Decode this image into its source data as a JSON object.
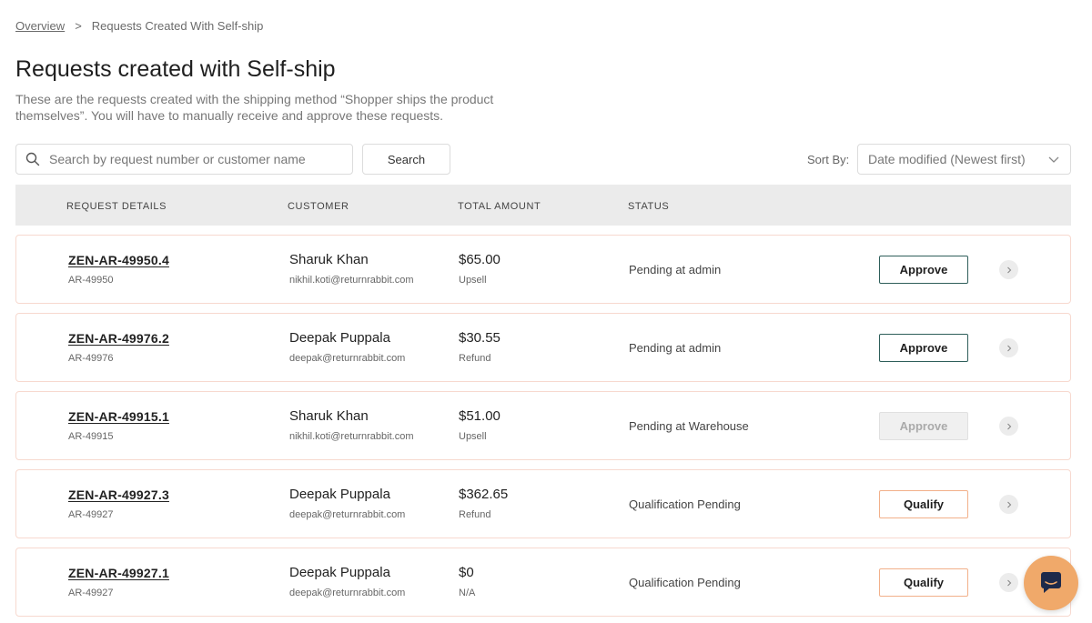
{
  "breadcrumb": {
    "root": "Overview",
    "separator": ">",
    "current": "Requests Created With Self-ship"
  },
  "page": {
    "title": "Requests created with Self-ship",
    "description": "These are the requests created with the shipping method “Shopper ships the product themselves”. You will have to manually receive and approve these requests."
  },
  "search": {
    "placeholder": "Search by request number or customer name",
    "value": "",
    "button_label": "Search",
    "icon": "search-icon"
  },
  "sort": {
    "label": "Sort By:",
    "selected": "Date modified (Newest first)",
    "icon": "chevron-down-icon"
  },
  "table": {
    "headers": {
      "details": "REQUEST DETAILS",
      "customer": "CUSTOMER",
      "amount": "TOTAL AMOUNT",
      "status": "STATUS"
    },
    "rows": [
      {
        "id": "ZEN-AR-49950.4",
        "sub": "AR-49950",
        "customer": "Sharuk Khan",
        "email": "nikhil.koti@returnrabbit.com",
        "amount": "$65.00",
        "type": "Upsell",
        "status": "Pending at admin",
        "action": "Approve",
        "action_state": "approve"
      },
      {
        "id": "ZEN-AR-49976.2",
        "sub": "AR-49976",
        "customer": "Deepak Puppala",
        "email": "deepak@returnrabbit.com",
        "amount": "$30.55",
        "type": "Refund",
        "status": "Pending at admin",
        "action": "Approve",
        "action_state": "approve"
      },
      {
        "id": "ZEN-AR-49915.1",
        "sub": "AR-49915",
        "customer": "Sharuk Khan",
        "email": "nikhil.koti@returnrabbit.com",
        "amount": "$51.00",
        "type": "Upsell",
        "status": "Pending at Warehouse",
        "action": "Approve",
        "action_state": "disabled"
      },
      {
        "id": "ZEN-AR-49927.3",
        "sub": "AR-49927",
        "customer": "Deepak Puppala",
        "email": "deepak@returnrabbit.com",
        "amount": "$362.65",
        "type": "Refund",
        "status": "Qualification Pending",
        "action": "Qualify",
        "action_state": "qualify"
      },
      {
        "id": "ZEN-AR-49927.1",
        "sub": "AR-49927",
        "customer": "Deepak Puppala",
        "email": "deepak@returnrabbit.com",
        "amount": "$0",
        "type": "N/A",
        "status": "Qualification Pending",
        "action": "Qualify",
        "action_state": "qualify"
      }
    ]
  },
  "chat": {
    "icon": "chat-bubble-icon",
    "color": "#f0a96a"
  },
  "colors": {
    "row_border": "#f7d9cf",
    "approve_border": "#2e5e5a",
    "qualify_border": "#f2b08a",
    "header_bg": "#ebebeb"
  }
}
